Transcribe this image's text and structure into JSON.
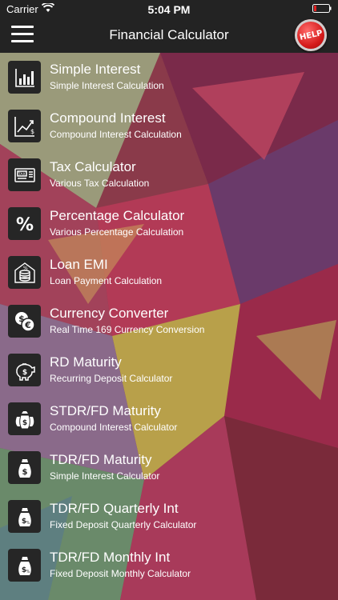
{
  "status_bar": {
    "carrier": "Carrier",
    "time": "5:04 PM"
  },
  "header": {
    "title": "Financial Calculator",
    "help_label": "HELP"
  },
  "items": [
    {
      "title": "Simple Interest",
      "subtitle": "Simple Interest Calculation",
      "icon": "bar-chart-icon"
    },
    {
      "title": "Compound Interest",
      "subtitle": "Compound Interest Calculation",
      "icon": "growth-chart-icon"
    },
    {
      "title": "Tax Calculator",
      "subtitle": "Various Tax Calculation",
      "icon": "tax-receipt-icon"
    },
    {
      "title": "Percentage Calculator",
      "subtitle": "Various Percentage Calculation",
      "icon": "percent-icon"
    },
    {
      "title": "Loan EMI",
      "subtitle": "Loan Payment Calculation",
      "icon": "coin-stack-icon"
    },
    {
      "title": "Currency Converter",
      "subtitle": "Real Time 169 Currency Conversion",
      "icon": "currency-exchange-icon"
    },
    {
      "title": "RD Maturity",
      "subtitle": "Recurring Deposit Calculator",
      "icon": "piggy-bank-icon"
    },
    {
      "title": "STDR/FD Maturity",
      "subtitle": "Compound Interest Calculator",
      "icon": "money-bags-icon"
    },
    {
      "title": "TDR/FD Maturity",
      "subtitle": "Simple Interest Calculator",
      "icon": "money-bag-icon"
    },
    {
      "title": "TDR/FD Quarterly Int",
      "subtitle": "Fixed Deposit Quarterly Calculator",
      "icon": "money-bag-quarterly-icon"
    },
    {
      "title": "TDR/FD Monthly Int",
      "subtitle": "Fixed Deposit Monthly Calculator",
      "icon": "money-bag-monthly-icon"
    }
  ]
}
